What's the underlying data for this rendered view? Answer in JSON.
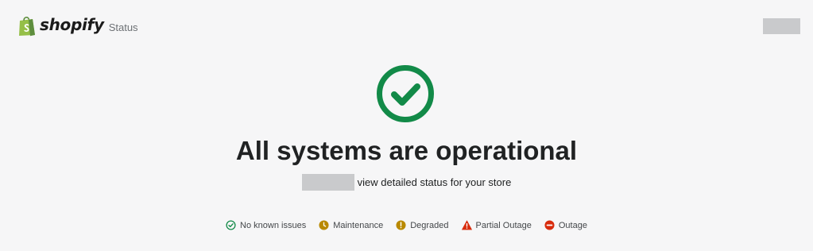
{
  "header": {
    "brand_name": "shopify",
    "brand_suffix": "Status",
    "logo_icon": "shopify-bag-icon",
    "brand_color": "#95bf47"
  },
  "hero": {
    "icon": "check-circle-icon",
    "icon_color": "#128a48",
    "headline": "All systems are operational",
    "subtext": "view detailed status for your store"
  },
  "legend": {
    "items": [
      {
        "label": "No known issues",
        "icon": "check-circle-icon",
        "color": "#128a48"
      },
      {
        "label": "Maintenance",
        "icon": "clock-icon",
        "color": "#b98900"
      },
      {
        "label": "Degraded",
        "icon": "exclamation-circle-icon",
        "color": "#b98900"
      },
      {
        "label": "Partial Outage",
        "icon": "warning-triangle-icon",
        "color": "#d82c0d"
      },
      {
        "label": "Outage",
        "icon": "minus-circle-icon",
        "color": "#d82c0d"
      }
    ]
  }
}
